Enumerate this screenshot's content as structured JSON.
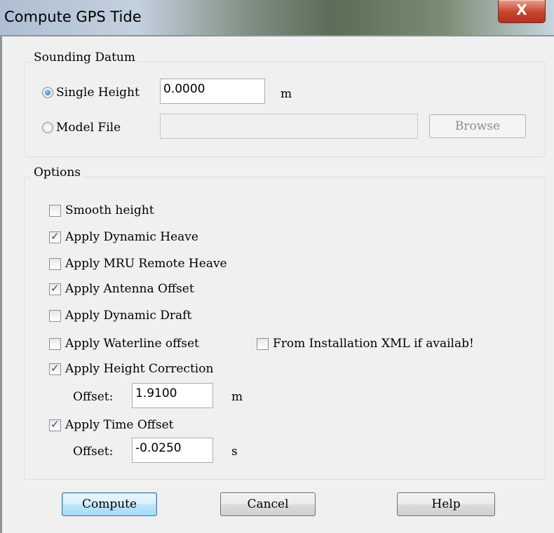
{
  "window": {
    "title": "Compute GPS Tide",
    "close_label": "X"
  },
  "sounding_datum": {
    "legend": "Sounding Datum",
    "single_height_label": "Single Height",
    "single_height_value": "0.0000",
    "single_height_unit": "m",
    "single_height_selected": true,
    "model_file_label": "Model File",
    "model_file_value": "",
    "model_file_selected": false,
    "browse_label": "Browse"
  },
  "options": {
    "legend": "Options",
    "smooth_height": {
      "label": "Smooth height",
      "checked": false
    },
    "apply_dynamic_heave": {
      "label": "Apply Dynamic Heave",
      "checked": true
    },
    "apply_mru_remote_heave": {
      "label": "Apply MRU Remote Heave",
      "checked": false
    },
    "apply_antenna_offset": {
      "label": "Apply Antenna Offset",
      "checked": true
    },
    "apply_dynamic_draft": {
      "label": "Apply Dynamic Draft",
      "checked": false
    },
    "apply_waterline_offset": {
      "label": "Apply Waterline offset",
      "checked": false
    },
    "from_installation_xml": {
      "label": "From Installation XML if availab!",
      "checked": false
    },
    "apply_height_correction": {
      "label": "Apply Height Correction",
      "checked": true
    },
    "height_offset_label": "Offset:",
    "height_offset_value": "1.9100",
    "height_offset_unit": "m",
    "apply_time_offset": {
      "label": "Apply Time Offset",
      "checked": true
    },
    "time_offset_label": "Offset:",
    "time_offset_value": "-0.0250",
    "time_offset_unit": "s"
  },
  "buttons": {
    "compute": "Compute",
    "cancel": "Cancel",
    "help": "Help"
  }
}
